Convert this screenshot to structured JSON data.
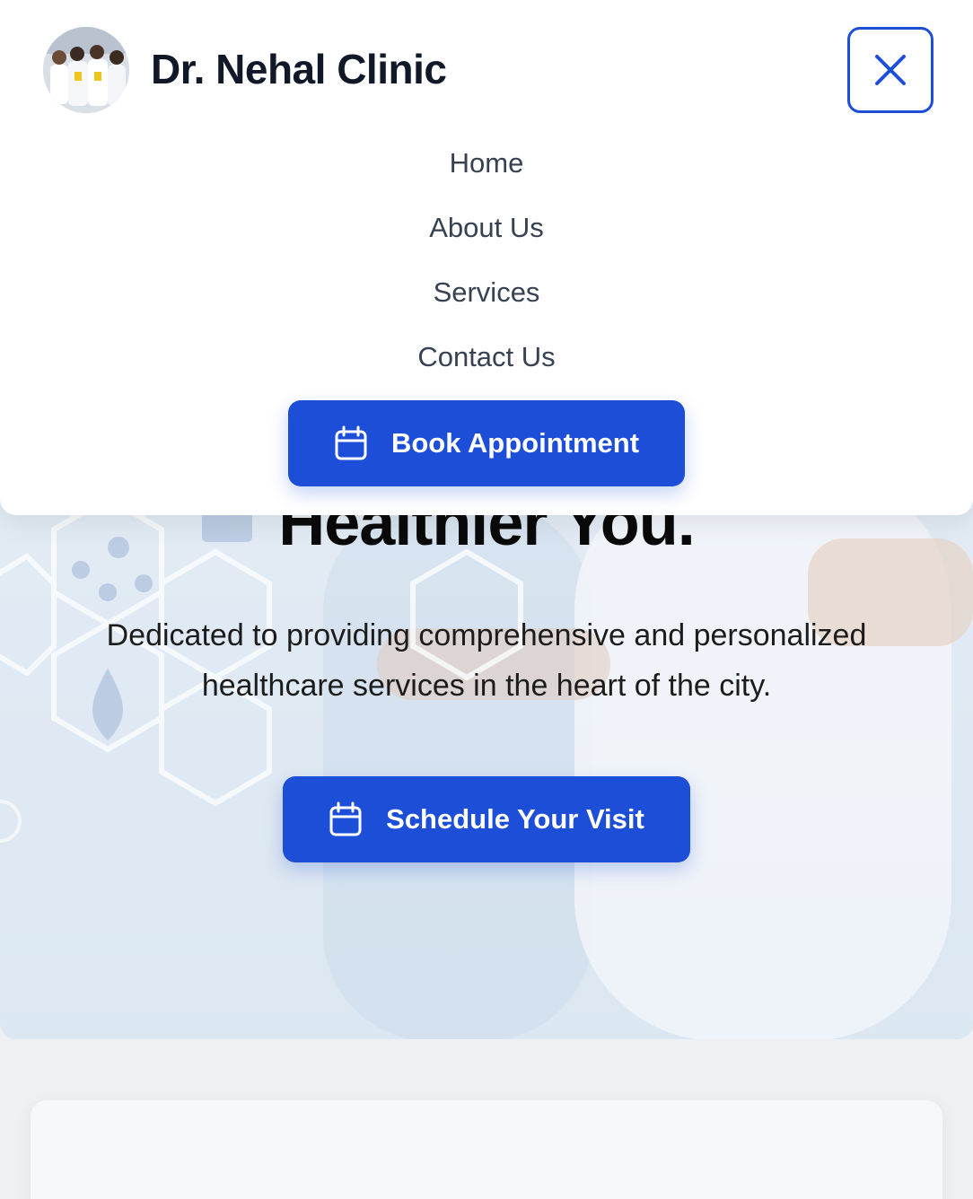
{
  "header": {
    "brand_name": "Dr. Nehal Clinic",
    "logo_icon": "doctors-team-photo",
    "close_icon": "close-icon"
  },
  "nav": {
    "items": [
      {
        "label": "Home"
      },
      {
        "label": "About Us"
      },
      {
        "label": "Services"
      },
      {
        "label": "Contact Us"
      }
    ],
    "book_button": {
      "label": "Book Appointment",
      "icon": "calendar-icon"
    }
  },
  "hero": {
    "title_visible": "Healthier You.",
    "subtitle": "Dedicated to providing comprehensive and personalized healthcare services in the heart of the city.",
    "schedule_button": {
      "label": "Schedule Your Visit",
      "icon": "calendar-icon"
    }
  },
  "colors": {
    "accent": "#1d4ed8",
    "text_dark": "#111827",
    "nav_text": "#374151"
  }
}
